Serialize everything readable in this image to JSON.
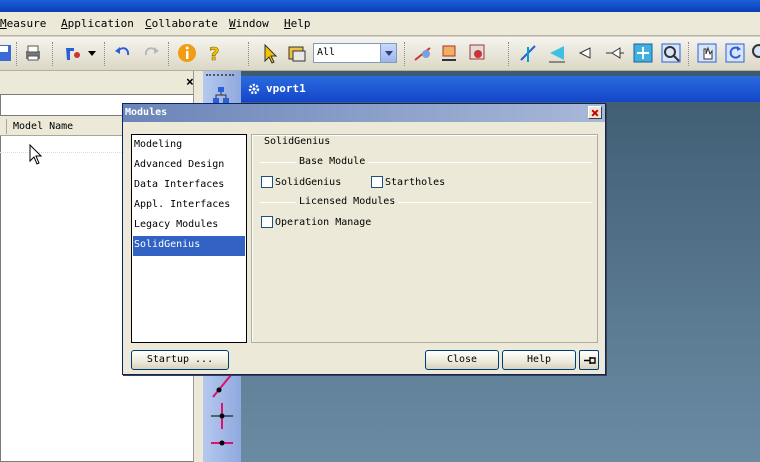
{
  "menubar": {
    "items": [
      {
        "first": "M",
        "rest": "easure"
      },
      {
        "first": "A",
        "rest": "pplication"
      },
      {
        "first": "C",
        "rest": "ollaborate"
      },
      {
        "first": "W",
        "rest": "indow"
      },
      {
        "first": "H",
        "rest": "elp"
      }
    ]
  },
  "toolbar": {
    "filter_value": "All",
    "icons": [
      "save-icon",
      "print-icon",
      "tools-icon",
      "undo-icon",
      "redo-icon",
      "info-icon",
      "help-icon",
      "select-arrow-icon",
      "filter-icon",
      "measure-icon",
      "transform-icon",
      "paint-icon",
      "section-icon",
      "align-icon",
      "align-left-icon",
      "align-center-icon",
      "fit-view-icon",
      "zoom-window-icon",
      "pan-icon",
      "rotate-icon",
      "zoom-icon"
    ],
    "colors": {
      "accent_blue": "#2b5fd9",
      "warn_orange": "#f39c12",
      "help_yellow": "#f5c400"
    }
  },
  "left_panel": {
    "close_glyph": "×",
    "column_header": "Model Name"
  },
  "viewport": {
    "title": "vport1"
  },
  "dialog": {
    "title": "Modules",
    "list": [
      "Modeling",
      "Advanced Design",
      "Data Interfaces",
      "Appl. Interfaces",
      "Legacy Modules",
      "SolidGenius"
    ],
    "selected_index": 5,
    "panel_title": "SolidGenius",
    "base_module": {
      "label": "Base Module",
      "options": [
        {
          "label": "SolidGenius",
          "checked": false
        },
        {
          "label": "Startholes",
          "checked": false
        }
      ]
    },
    "licensed_modules": {
      "label": "Licensed Modules",
      "options": [
        {
          "label": "Operation Manage",
          "checked": false
        }
      ]
    },
    "buttons": {
      "startup": "Startup ...",
      "close": "Close",
      "help": "Help"
    }
  }
}
